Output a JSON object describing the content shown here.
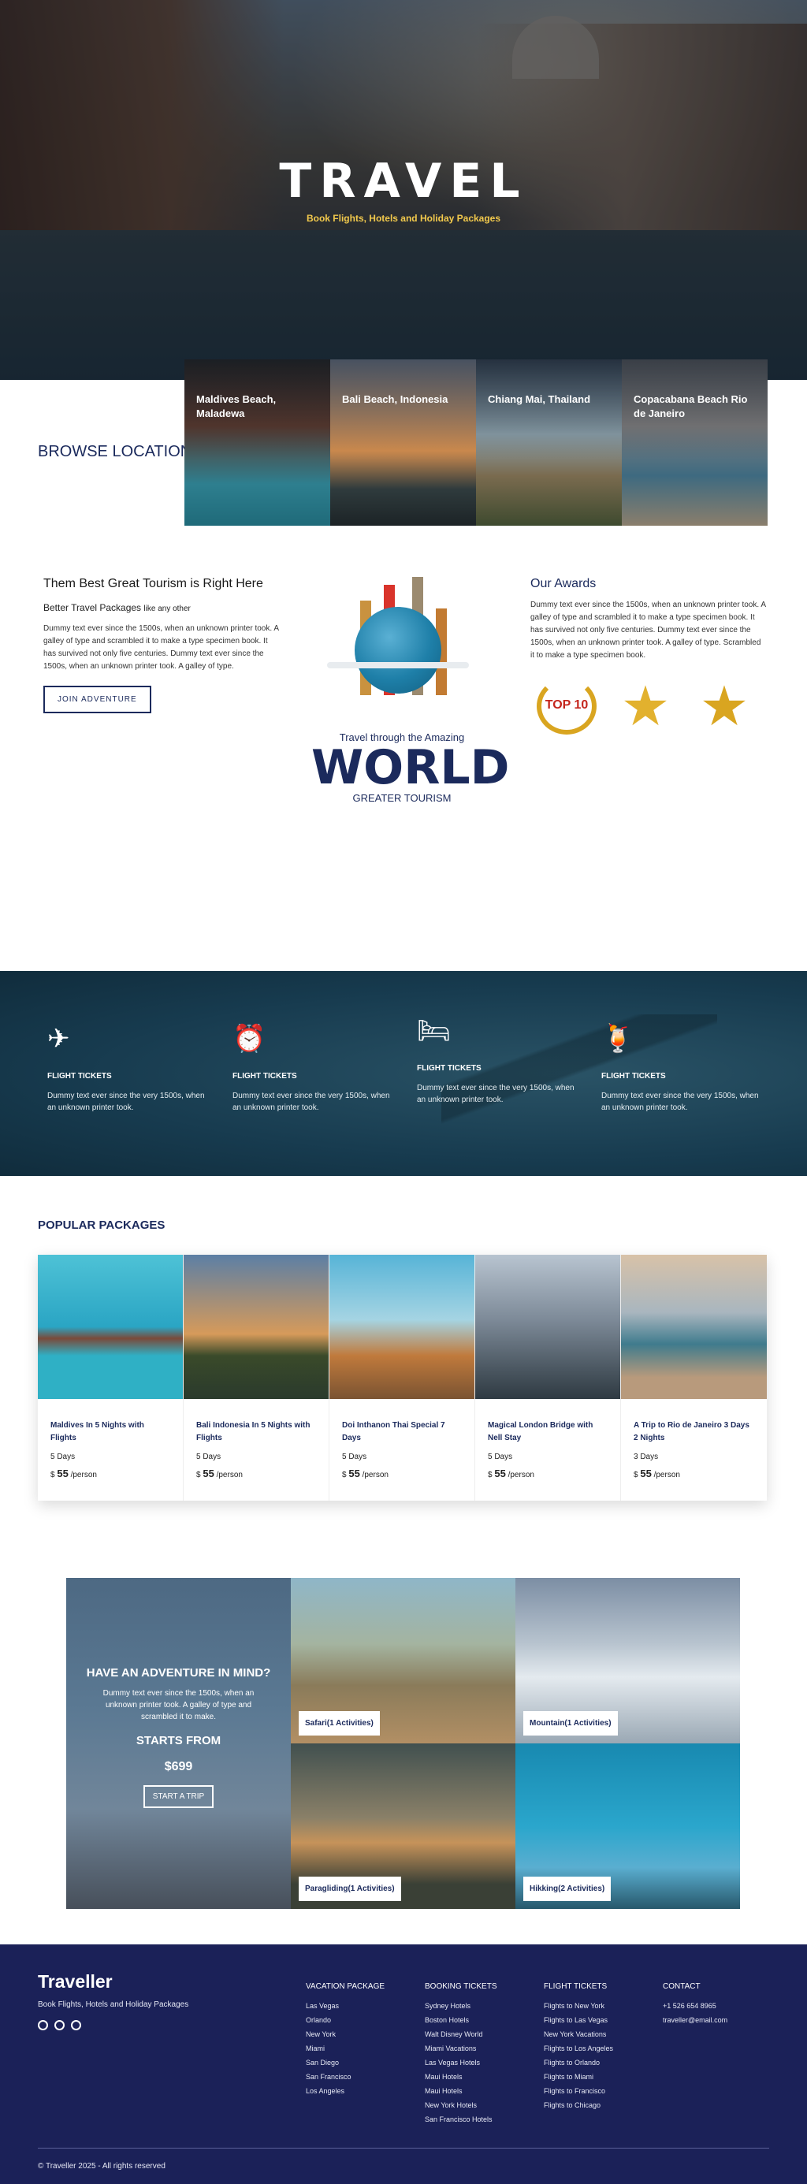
{
  "hero": {
    "title": "TRAVEL",
    "tagline": "Book Flights, Hotels and Holiday Packages"
  },
  "browse": {
    "title": "BROWSE LOCATIONS",
    "locations": [
      {
        "name": "Maldives Beach, Maladewa"
      },
      {
        "name": "Bali Beach, Indonesia"
      },
      {
        "name": "Chiang Mai, Thailand"
      },
      {
        "name": "Copacabana Beach Rio de Janeiro"
      }
    ]
  },
  "tourism": {
    "heading": "Them Best Great Tourism is Right Here",
    "sub_main": "Better Travel Packages",
    "sub_small": "like any other",
    "text": "Dummy text ever since the 1500s, when an unknown printer took. A galley of type and scrambled it to make a type specimen book. It has survived not only five centuries. Dummy text ever since the 1500s, when an unknown printer took. A galley of type.",
    "button": "JOIN ADVENTURE",
    "center_through": "Travel through the Amazing",
    "center_world": "WORLD",
    "center_greater": "GREATER TOURISM",
    "awards_heading": "Our Awards",
    "awards_text": "Dummy text ever since the 1500s, when an unknown printer took. A galley of type and scrambled it to make a type specimen book. It has survived not only five centuries. Dummy text ever since the 1500s, when an unknown printer took. A galley of type. Scrambled it to make a type specimen book.",
    "award_badges": [
      "TOP 10",
      "",
      ""
    ]
  },
  "features": [
    {
      "icon": "plane-icon",
      "title": "FLIGHT TICKETS",
      "text": "Dummy text ever since the very 1500s, when an unknown printer took."
    },
    {
      "icon": "alarm-clock-icon",
      "title": "FLIGHT TICKETS",
      "text": "Dummy text ever since the very 1500s, when an unknown printer took."
    },
    {
      "icon": "bed-icon",
      "title": "FLIGHT TICKETS",
      "text": "Dummy text ever since the very 1500s, when an unknown printer took."
    },
    {
      "icon": "drink-icon",
      "title": "FLIGHT TICKETS",
      "text": "Dummy text ever since the very 1500s, when an unknown printer took."
    }
  ],
  "popular": {
    "title": "POPULAR PACKAGES",
    "packages": [
      {
        "title": "Maldives In 5 Nights with Flights",
        "days": "5 Days",
        "currency": "$",
        "price": "55",
        "per": "/person"
      },
      {
        "title": "Bali Indonesia In 5 Nights with Flights",
        "days": "5 Days",
        "currency": "$",
        "price": "55",
        "per": "/person"
      },
      {
        "title": "Doi Inthanon Thai Special 7 Days",
        "days": "5 Days",
        "currency": "$",
        "price": "55",
        "per": "/person"
      },
      {
        "title": "Magical London Bridge with Nell Stay",
        "days": "5 Days",
        "currency": "$",
        "price": "55",
        "per": "/person"
      },
      {
        "title": "A Trip to Rio de Janeiro 3 Days 2 Nights",
        "days": "3 Days",
        "currency": "$",
        "price": "55",
        "per": "/person"
      }
    ]
  },
  "adventure": {
    "heading": "HAVE AN ADVENTURE IN MIND?",
    "text": "Dummy text ever since the 1500s, when an unknown printer took. A galley of type and scrambled it to make.",
    "starts_from": "STARTS FROM",
    "price": "$699",
    "button": "START A TRIP",
    "tiles": [
      {
        "label": "Safari(1 Activities)"
      },
      {
        "label": "Mountain(1 Activities)"
      },
      {
        "label": "Paragliding(1 Activities)"
      },
      {
        "label": "Hikking(2 Activities)"
      }
    ]
  },
  "footer": {
    "brand": "Traveller",
    "tagline": "Book Flights, Hotels and Holiday Packages",
    "social": [
      "facebook-icon",
      "instagram-icon",
      "github-icon"
    ],
    "columns": [
      {
        "heading": "VACATION PACKAGE",
        "items": [
          "Las Vegas",
          "Orlando",
          "New York",
          "Miami",
          "San Diego",
          "San Francisco",
          "Los Angeles"
        ]
      },
      {
        "heading": "BOOKING TICKETS",
        "items": [
          "Sydney Hotels",
          "Boston Hotels",
          "Walt Disney World",
          "Miami Vacations",
          "Las Vegas Hotels",
          "Maui Hotels",
          "Maui Hotels",
          "New York Hotels",
          "San Francisco Hotels"
        ]
      },
      {
        "heading": "FLIGHT TICKETS",
        "items": [
          "Flights to New York",
          "Flights to Las Vegas",
          "New York Vacations",
          "Flights to Los Angeles",
          "Flights to Orlando",
          "Flights to Miami",
          "Flights to Francisco",
          "Flights to Chicago"
        ]
      },
      {
        "heading": "CONTACT",
        "items": [
          "+1 526 654 8965",
          "traveller@email.com"
        ]
      }
    ],
    "copyright": "© Traveller 2025 - All rights reserved"
  }
}
